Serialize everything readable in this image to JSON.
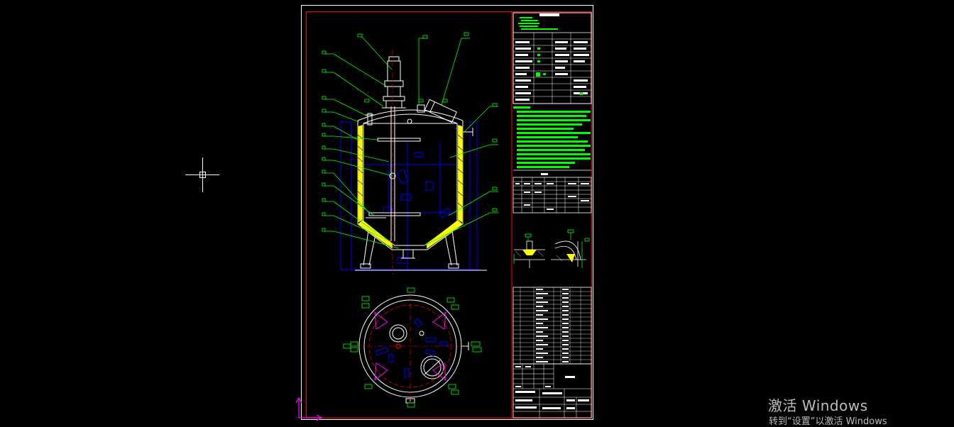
{
  "canvas": {
    "background": "#000000"
  },
  "colors": {
    "sheet_border": "#ffffff",
    "frame": "#ff0000",
    "leader": "#00ff00",
    "outline": "#ffffff",
    "hidden_line": "#0000ff",
    "insulation": "#ffff00",
    "manway": "#ff00ff",
    "axis": "#ff0000",
    "ucs": "#ff00ff",
    "crosshair": "#ffffff"
  },
  "icons": {
    "crosshair": "crosshair-cursor-icon",
    "ucs": "ucs-axis-icon"
  },
  "watermark": {
    "title": "激活 Windows",
    "subtitle": "转到“设置”以激活 Windows"
  }
}
